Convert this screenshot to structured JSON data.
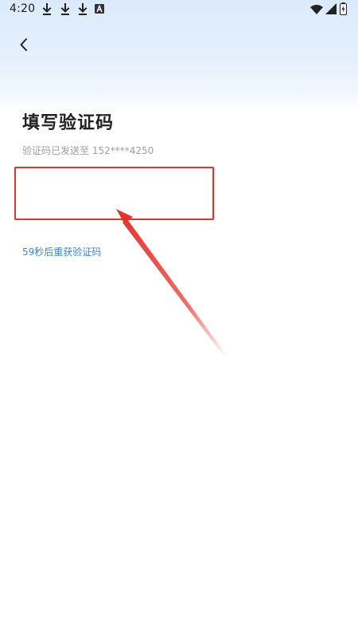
{
  "status_bar": {
    "time": "4:20",
    "notification_icons": [
      "download-icon",
      "download-icon",
      "download-icon",
      "a-badge-icon"
    ],
    "system_icons": [
      "wifi-icon",
      "signal-icon",
      "battery-charging-icon"
    ]
  },
  "header": {
    "back_icon": "chevron-left-icon"
  },
  "main": {
    "title": "填写验证码",
    "sent_to": "验证码已发送至 152****4250",
    "code_value": "",
    "resend_countdown": "59秒后重获验证码"
  },
  "annotation": {
    "highlight_color": "#e8302c",
    "arrow_color": "#e8302c"
  },
  "colors": {
    "accent": "#2f88e6",
    "title": "#222222",
    "subtle_text": "#9a9fa8"
  }
}
